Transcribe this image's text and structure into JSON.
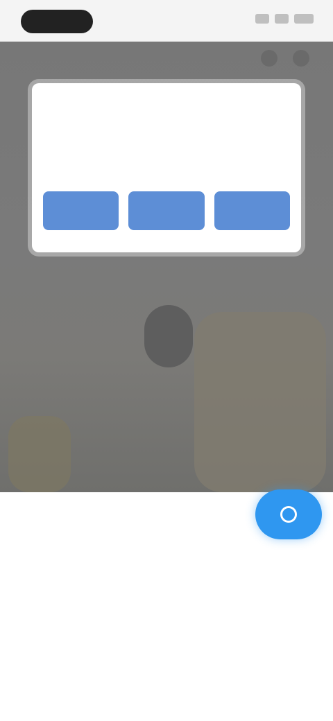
{
  "status_bar": {
    "time": "",
    "icons": [
      "signal-icon",
      "wifi-icon",
      "battery-icon"
    ]
  },
  "camera": {
    "toolbar_icons": [
      "flash-icon",
      "settings-icon"
    ]
  },
  "dialog": {
    "title": "",
    "line1": "",
    "line2": "",
    "buttons": [
      {
        "label": ""
      },
      {
        "label": ""
      },
      {
        "label": ""
      }
    ]
  },
  "panel": {
    "label": "",
    "shutter_icon": "camera-icon",
    "modes": [
      {
        "label": "",
        "sub": "",
        "sub2": ""
      },
      {
        "label": "",
        "sub": "",
        "sub2": ""
      },
      {
        "label": "",
        "sub": "",
        "sub2": ""
      }
    ]
  },
  "colors": {
    "accent": "#2f97f0",
    "dialog_button": "#5d8ed6",
    "camera_bg": "#777777"
  }
}
